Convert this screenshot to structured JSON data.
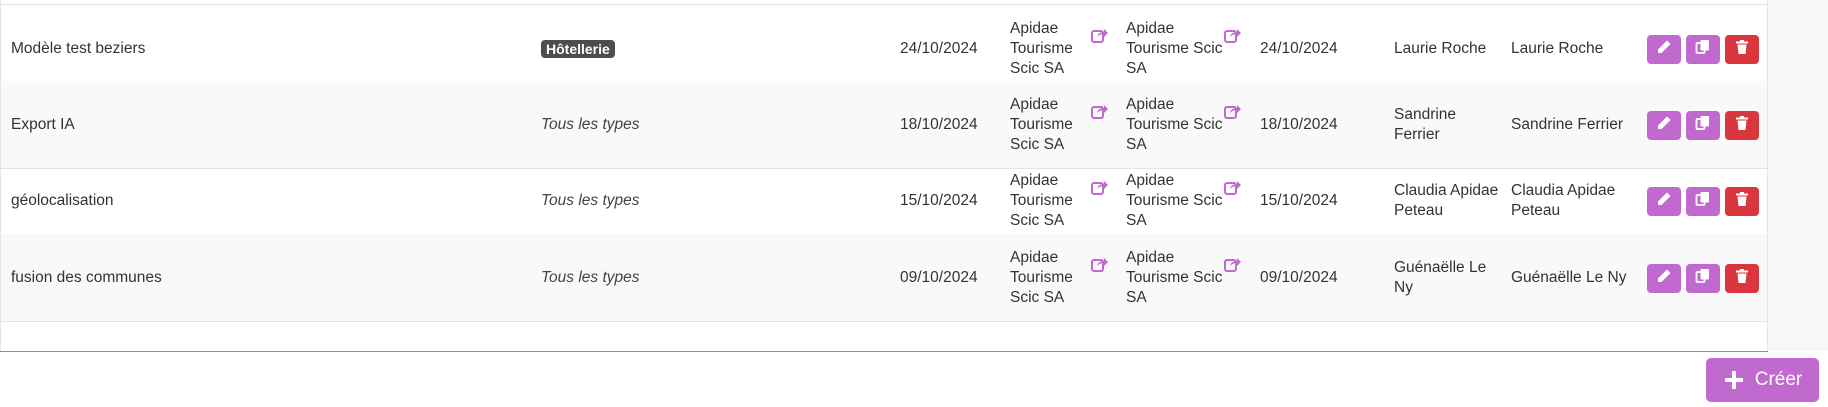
{
  "rows": [
    {
      "name": "Modèle test beziers",
      "type_badge": "Hôtellerie",
      "type_text": "",
      "date_created": "24/10/2024",
      "org_owner": "Apidae Tourisme Scic SA",
      "org_creator": "Apidae Tourisme Scic SA",
      "date_modified": "24/10/2024",
      "created_by": "Laurie Roche",
      "modified_by": "Laurie Roche"
    },
    {
      "name": "Export IA",
      "type_badge": "",
      "type_text": "Tous les types",
      "date_created": "18/10/2024",
      "org_owner": "Apidae Tourisme Scic SA",
      "org_creator": "Apidae Tourisme Scic SA",
      "date_modified": "18/10/2024",
      "created_by": "Sandrine Ferrier",
      "modified_by": "Sandrine Ferrier"
    },
    {
      "name": "géolocalisation",
      "type_badge": "",
      "type_text": "Tous les types",
      "date_created": "15/10/2024",
      "org_owner": "Apidae Tourisme Scic SA",
      "org_creator": "Apidae Tourisme Scic SA",
      "date_modified": "15/10/2024",
      "created_by": "Claudia Apidae Peteau",
      "modified_by": "Claudia Apidae Peteau"
    },
    {
      "name": "fusion des communes",
      "type_badge": "",
      "type_text": "Tous les types",
      "date_created": "09/10/2024",
      "org_owner": "Apidae Tourisme Scic SA",
      "org_creator": "Apidae Tourisme Scic SA",
      "date_modified": "09/10/2024",
      "created_by": "Guénaëlle Le Ny",
      "modified_by": "Guénaëlle Le Ny"
    }
  ],
  "icons": {
    "share": "share-icon",
    "edit": "pencil-icon",
    "duplicate": "copy-icon",
    "delete": "trash-icon",
    "create": "plus-icon"
  },
  "colors": {
    "accent": "#c06ad0",
    "danger": "#d9363e",
    "badge": "#4d4d4d"
  },
  "create_button": {
    "label": "Créer"
  }
}
